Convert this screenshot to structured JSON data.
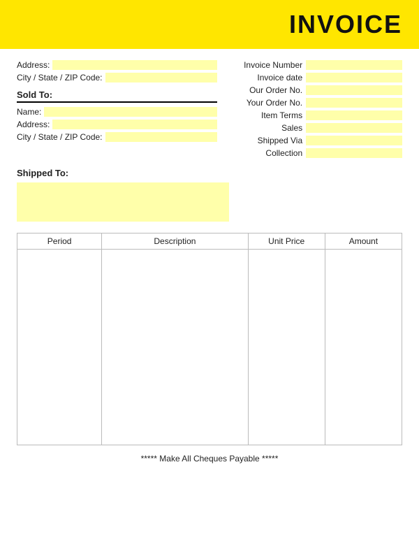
{
  "header": {
    "title": "INVOICE"
  },
  "left_top": {
    "address_label": "Address:",
    "city_label": "City / State / ZIP Code:"
  },
  "sold_to": {
    "label": "Sold To:",
    "name_label": "Name:",
    "address_label": "Address:",
    "city_label": "City / State / ZIP Code:"
  },
  "shipped_to": {
    "label": "Shipped To:"
  },
  "right_fields": [
    {
      "label": "Invoice Number"
    },
    {
      "label": "Invoice date"
    },
    {
      "label": "Our Order No."
    },
    {
      "label": "Your Order No."
    },
    {
      "label": "Item Terms"
    },
    {
      "label": "Sales"
    },
    {
      "label": "Shipped Via"
    },
    {
      "label": "Collection"
    }
  ],
  "table": {
    "columns": [
      "Period",
      "Description",
      "Unit Price",
      "Amount"
    ]
  },
  "footer": {
    "text": "***** Make All Cheques Payable *****"
  }
}
